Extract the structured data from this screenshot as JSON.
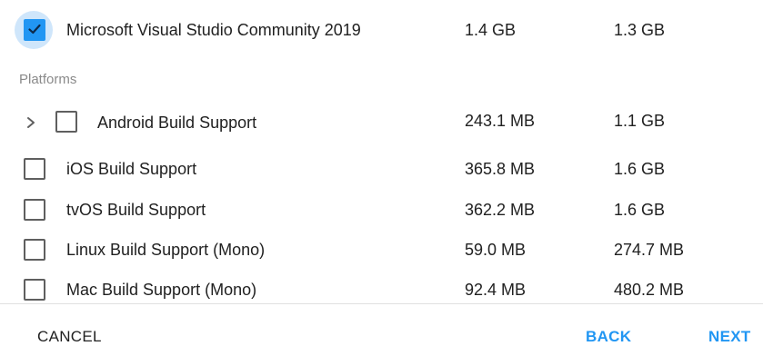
{
  "items": [
    {
      "label": "Microsoft Visual Studio Community 2019",
      "download": "1.4 GB",
      "installed": "1.3 GB",
      "checked": true
    },
    {
      "label": "Android Build Support",
      "download": "243.1 MB",
      "installed": "1.1 GB",
      "checked": false,
      "expandable": true
    },
    {
      "label": "iOS Build Support",
      "download": "365.8 MB",
      "installed": "1.6 GB",
      "checked": false
    },
    {
      "label": "tvOS Build Support",
      "download": "362.2 MB",
      "installed": "1.6 GB",
      "checked": false
    },
    {
      "label": "Linux Build Support (Mono)",
      "download": "59.0 MB",
      "installed": "274.7 MB",
      "checked": false
    },
    {
      "label": "Mac Build Support (Mono)",
      "download": "92.4 MB",
      "installed": "480.2 MB",
      "checked": false
    }
  ],
  "section_header": "Platforms",
  "footer": {
    "cancel_label": "CANCEL",
    "back_label": "BACK",
    "next_label": "NEXT"
  },
  "colors": {
    "accent": "#2196f3",
    "check_halo": "#cfe6fb",
    "text": "#212121",
    "muted": "#8a8a8a",
    "divider": "#e0e0e0"
  },
  "icons": {
    "checkmark": "check-icon",
    "expand": "chevron-right-icon"
  }
}
